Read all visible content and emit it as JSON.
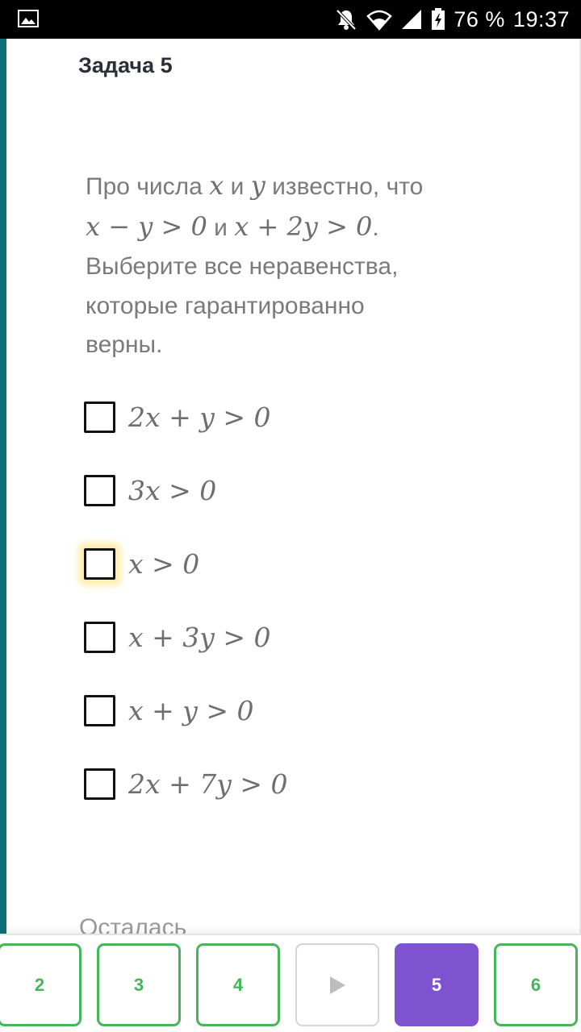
{
  "status_bar": {
    "battery": "76 %",
    "time": "19:37",
    "icons": [
      "gallery-icon",
      "notifications-off-icon",
      "wifi-icon",
      "signal-icon",
      "battery-charging-icon"
    ]
  },
  "task": {
    "title": "Задача 5",
    "problem": {
      "intro": "Про числа",
      "var_x": "x",
      "and1": "и",
      "var_y": "y",
      "known": "известно, что",
      "cond1": "x − y > 0",
      "and2": "и",
      "cond2": "x + 2y > 0",
      "period": ".",
      "instruction_line1": "Выберите все неравенства,",
      "instruction_line2": "которые гарантированно",
      "instruction_line3": "верны."
    },
    "options": [
      {
        "label": "2x + y > 0",
        "checked": false
      },
      {
        "label": "3x > 0",
        "checked": false
      },
      {
        "label": "x > 0",
        "checked": false,
        "highlighted": true
      },
      {
        "label": "x + 3y > 0",
        "checked": false
      },
      {
        "label": "x + y > 0",
        "checked": false
      },
      {
        "label": "2x + 7y > 0",
        "checked": false
      }
    ],
    "remaining_text": "Осталась"
  },
  "bottom_nav": {
    "items": [
      {
        "label": "2",
        "state": "done"
      },
      {
        "label": "3",
        "state": "done"
      },
      {
        "label": "4",
        "state": "done"
      },
      {
        "label": "",
        "state": "play",
        "icon": "play-icon"
      },
      {
        "label": "5",
        "state": "active"
      },
      {
        "label": "6",
        "state": "done"
      }
    ]
  },
  "colors": {
    "accent_teal": "#0e6f78",
    "done_green": "#44b658",
    "active_purple": "#7f53d0"
  }
}
